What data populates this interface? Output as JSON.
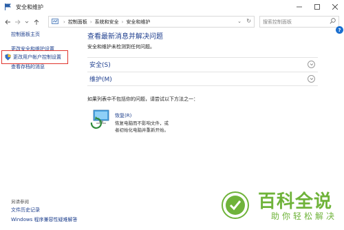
{
  "window": {
    "title": "安全和维护"
  },
  "address": {
    "segments": [
      "控制面板",
      "系统和安全",
      "安全和维护"
    ],
    "search_placeholder": "搜索控制面板"
  },
  "sidebar": {
    "home": "控制面板主页",
    "items": [
      {
        "label": "更改安全和维护设置"
      },
      {
        "label": "更改用户帐户控制设置"
      },
      {
        "label": "查看存档的消息"
      }
    ],
    "see_also_label": "另请参阅",
    "see_also": [
      {
        "label": "文件历史记录"
      },
      {
        "label": "Windows 程序兼容性疑难解答"
      }
    ]
  },
  "main": {
    "title": "查看最新消息并解决问题",
    "subtitle": "安全和维护未检测到任何问题。",
    "sections": [
      {
        "label": "安全(S)"
      },
      {
        "label": "维护(M)"
      }
    ],
    "hint": "如果列表中不包括你的问题，请尝试以下方法之一：",
    "recovery": {
      "link": "恢复(R)",
      "description": "恢复电脑而不影响文件，或者初始化电脑并重新开始。"
    }
  },
  "watermark": {
    "main": "百科全说",
    "sub": "助你轻松解决"
  },
  "colors": {
    "link": "#1c3e8c",
    "title": "#1f3f8f",
    "highlight_border": "#e0322b",
    "watermark": "#6fb33a"
  }
}
